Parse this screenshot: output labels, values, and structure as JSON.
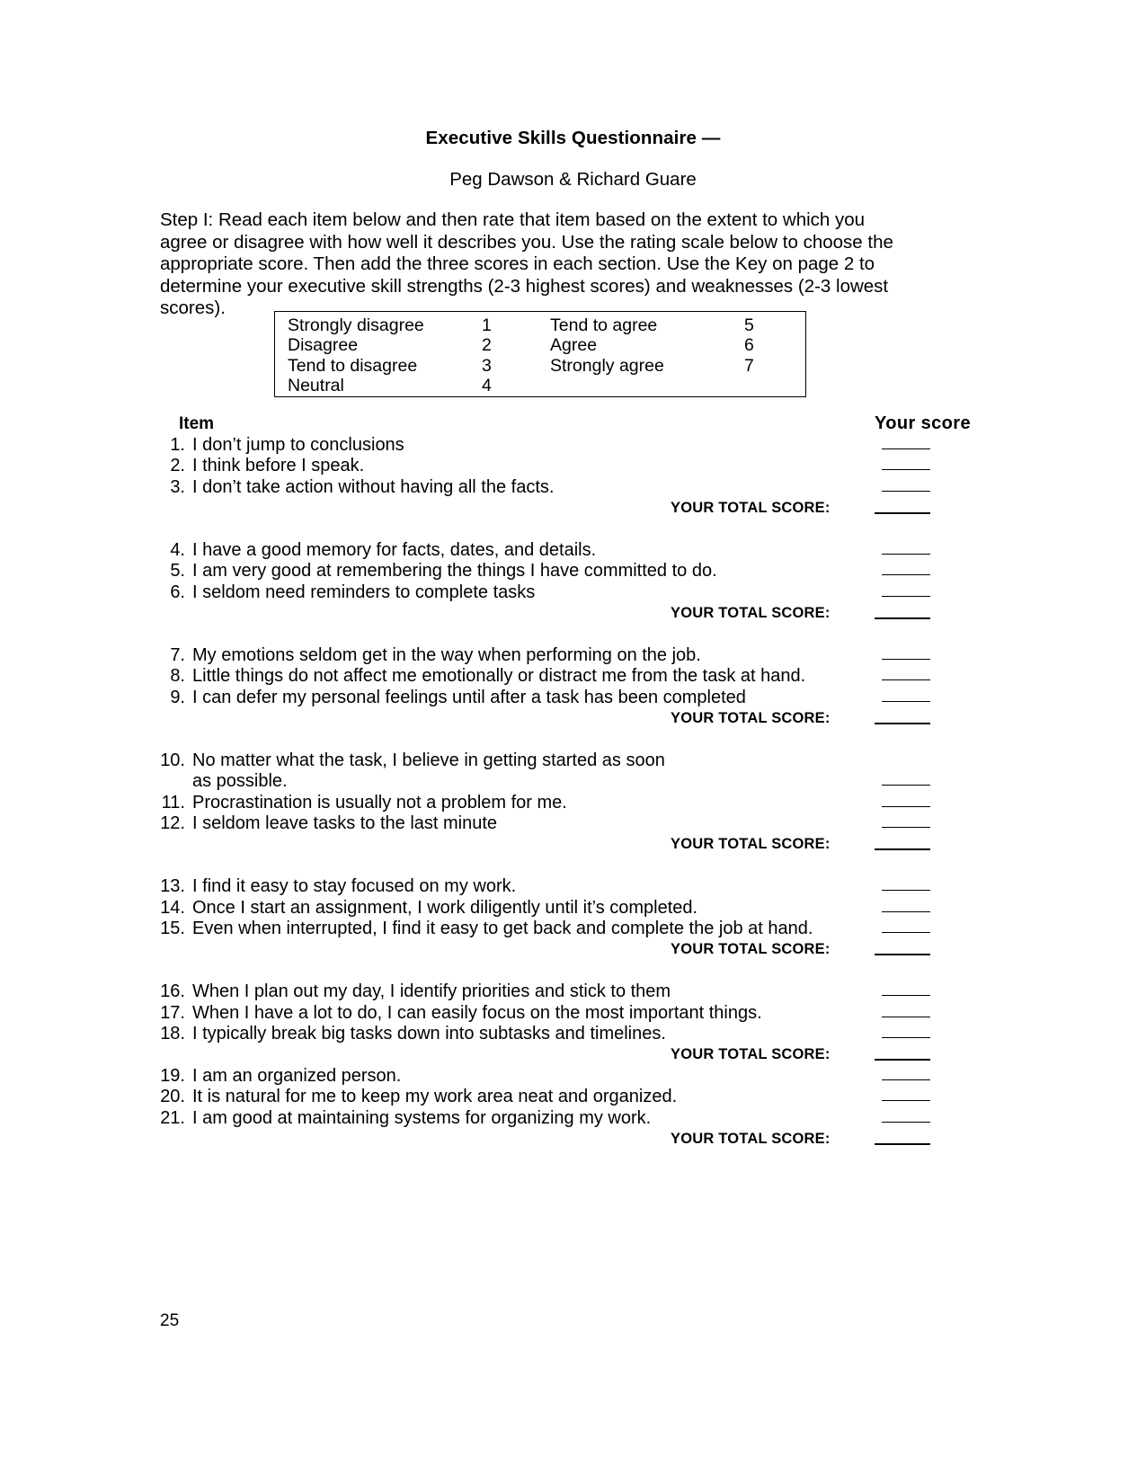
{
  "document": {
    "title": "Executive Skills Questionnaire —",
    "authors": "Peg Dawson & Richard Guare",
    "instructions": "Step I:  Read each item below and then rate that item based on the extent to which you agree or disagree with how well it describes you. Use the rating scale below to choose the appropriate score. Then add the three scores in each section. Use the Key on page 2 to determine your executive skill strengths (2-3 highest scores) and weaknesses (2-3 lowest scores).",
    "page_number": "25"
  },
  "rating_scale": {
    "rows": [
      {
        "label_left": "Strongly disagree",
        "value_left": "1",
        "label_right": "Tend to agree",
        "value_right": "5"
      },
      {
        "label_left": "Disagree",
        "value_left": "2",
        "label_right": "Agree",
        "value_right": "6"
      },
      {
        "label_left": "Tend to disagree",
        "value_left": "3",
        "label_right": "Strongly agree",
        "value_right": "7"
      },
      {
        "label_left": "Neutral",
        "value_left": "4",
        "label_right": "",
        "value_right": ""
      }
    ]
  },
  "headers": {
    "item": "Item",
    "your_score": "Your  score"
  },
  "total_label": "YOUR TOTAL SCORE:",
  "sections": [
    {
      "items": [
        {
          "number": "1.",
          "text": "I don’t jump to conclusions"
        },
        {
          "number": "2.",
          "text": "I think before I speak."
        },
        {
          "number": "3.",
          "text": "I don’t take action without having all the facts."
        }
      ]
    },
    {
      "items": [
        {
          "number": "4.",
          "text": "I have a good memory for facts, dates, and details."
        },
        {
          "number": "5.",
          "text": "I am very good at remembering the things I have committed to do."
        },
        {
          "number": "6.",
          "text": "I seldom need reminders to complete tasks"
        }
      ]
    },
    {
      "items": [
        {
          "number": "7.",
          "text": "My emotions seldom get in the way when performing on the job."
        },
        {
          "number": "8.",
          "text": "Little things do not affect me emotionally or distract me from the task at hand."
        },
        {
          "number": "9.",
          "text": "I can defer my personal feelings until after a task has been completed"
        }
      ]
    },
    {
      "items": [
        {
          "number": "10.",
          "text": "No matter what the task, I believe in getting started as soon",
          "continuation": "as possible."
        },
        {
          "number": "11.",
          "text": "Procrastination is usually not a problem for me."
        },
        {
          "number": "12.",
          "text": "I seldom leave tasks to the last minute"
        }
      ]
    },
    {
      "items": [
        {
          "number": "13.",
          "text": "I find it easy to stay focused on my work."
        },
        {
          "number": "14.",
          "text": "Once I start an assignment, I work diligently until it’s completed."
        },
        {
          "number": "15.",
          "text": "Even when interrupted, I find it easy to get back and complete the job at hand."
        }
      ]
    },
    {
      "items": [
        {
          "number": "16.",
          "text": "When I plan out my day, I identify priorities and stick to them"
        },
        {
          "number": "17.",
          "text": "When I have a lot to do, I can easily focus on the most important things."
        },
        {
          "number": "18.",
          "text": "I typically break big tasks down into subtasks and timelines."
        }
      ]
    },
    {
      "items": [
        {
          "number": "19.",
          "text": "I am an organized person."
        },
        {
          "number": "20.",
          "text": "It is natural for me to keep my work area neat and organized."
        },
        {
          "number": "21.",
          "text": "I am good at maintaining systems for organizing my work."
        }
      ]
    }
  ]
}
